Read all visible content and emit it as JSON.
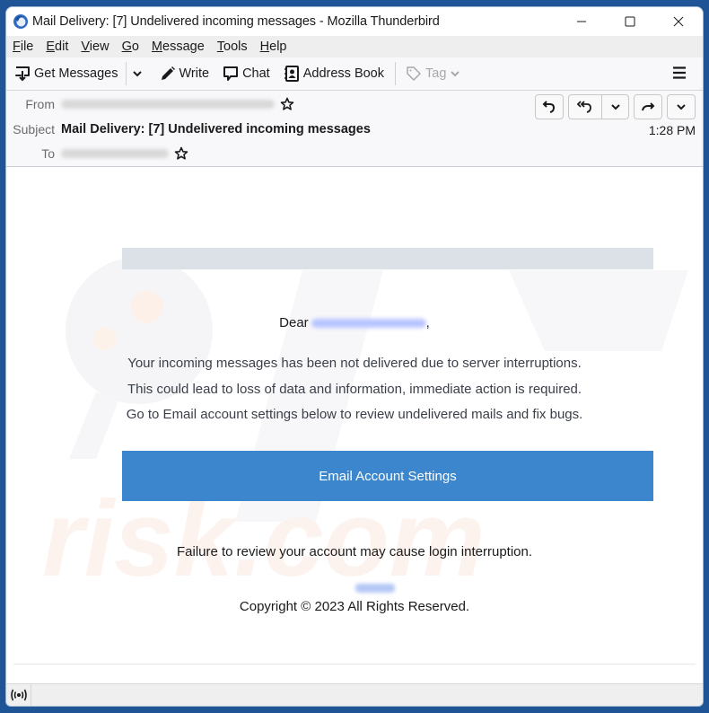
{
  "window": {
    "title": "Mail Delivery: [7] Undelivered incoming messages - Mozilla Thunderbird",
    "controls": [
      "minimize",
      "maximize",
      "close"
    ]
  },
  "menubar": {
    "items": [
      {
        "label": "File",
        "accel": "F",
        "rest": "ile"
      },
      {
        "label": "Edit",
        "accel": "E",
        "rest": "dit"
      },
      {
        "label": "View",
        "accel": "V",
        "rest": "iew"
      },
      {
        "label": "Go",
        "accel": "G",
        "rest": "o"
      },
      {
        "label": "Message",
        "accel": "M",
        "rest": "essage"
      },
      {
        "label": "Tools",
        "accel": "T",
        "rest": "ools"
      },
      {
        "label": "Help",
        "accel": "H",
        "rest": "elp"
      }
    ]
  },
  "toolbar": {
    "get_messages": "Get Messages",
    "write": "Write",
    "chat": "Chat",
    "address_book": "Address Book",
    "tag": "Tag"
  },
  "header": {
    "from_label": "From",
    "subject_label": "Subject",
    "to_label": "To",
    "subject": "Mail Delivery: [7] Undelivered incoming messages",
    "time": "1:28 PM",
    "from_value_redacted": true,
    "to_value_redacted": true
  },
  "body": {
    "greeting": "Dear",
    "greeting_suffix": ",",
    "paragraph_lines": [
      "Your incoming messages has been not delivered due to server interruptions.",
      "This could lead to loss of data and information, immediate action is required.",
      "Go to Email account settings below to review undelivered mails and fix bugs."
    ],
    "cta_label": "Email Account Settings",
    "warning": "Failure to review your account may cause login interruption.",
    "copyright": "Copyright © 2023 All Rights Reserved."
  },
  "colors": {
    "cta": "#3b86cc",
    "banner": "#dce1e8",
    "desktop": "#1f5496"
  }
}
